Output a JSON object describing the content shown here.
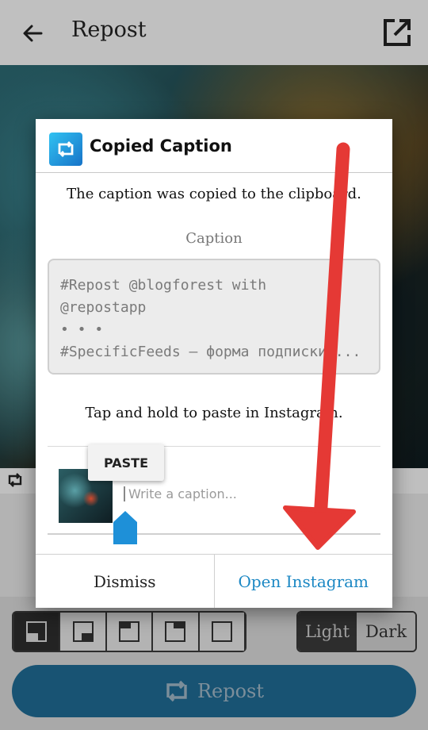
{
  "appbar": {
    "title": "Repost"
  },
  "theme": {
    "light": "Light",
    "dark": "Dark"
  },
  "repost_button": {
    "label": "Repost"
  },
  "dialog": {
    "title": "Copied Caption",
    "message": "The caption was copied to the clipboard.",
    "caption_label": "Caption",
    "caption_lines": [
      "#Repost @blogforest with",
      "@repostapp",
      " •  •  •",
      "#SpecificFeeds — форма подписки ..."
    ],
    "hint": "Tap and hold to paste in Instagram.",
    "paste_label": "PASTE",
    "caption_placeholder": "Write a caption...",
    "dismiss_label": "Dismiss",
    "open_label": "Open Instagram"
  },
  "colors": {
    "accent": "#1c88c4",
    "repost_button": "#1f6b94",
    "arrow": "#e53935"
  },
  "icons": [
    "back-arrow-icon",
    "share-external-icon",
    "repost-icon",
    "app-logo-icon",
    "text-cursor-handle-icon"
  ]
}
